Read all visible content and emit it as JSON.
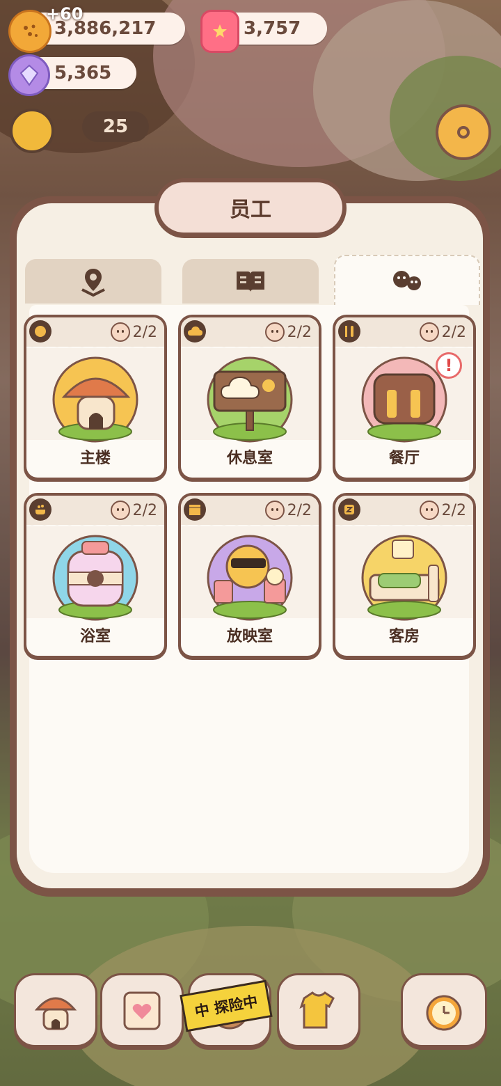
{
  "currencies": {
    "cookies": "3,886,217",
    "cookies_gain": "+60",
    "jelly": "3,757",
    "crystals": "5,365"
  },
  "hud": {
    "level_value": "25"
  },
  "panel": {
    "title": "员工",
    "tabs": [
      {
        "icon": "map-pin-icon",
        "active": false
      },
      {
        "icon": "book-icon",
        "active": false
      },
      {
        "icon": "cookie-group-icon",
        "active": true
      }
    ],
    "rooms": [
      {
        "label": "主楼",
        "count": "2/2",
        "icon": "cookie-icon"
      },
      {
        "label": "休息室",
        "count": "2/2",
        "icon": "cloud-icon"
      },
      {
        "label": "餐厅",
        "count": "2/2",
        "icon": "fork-knife-icon",
        "alert": "!"
      },
      {
        "label": "浴室",
        "count": "2/2",
        "icon": "bath-icon"
      },
      {
        "label": "放映室",
        "count": "2/2",
        "icon": "clapperboard-icon"
      },
      {
        "label": "客房",
        "count": "2/2",
        "icon": "sleep-icon"
      }
    ]
  },
  "bottom_nav": {
    "exploring_banner": "中 探险中",
    "items": [
      "house-icon",
      "diary-icon",
      "explore-icon",
      "shirt-icon",
      "alarm-clock-icon"
    ]
  },
  "colors": {
    "frame": "#7c5446",
    "panel": "#f6efe4",
    "card": "#fdfaf5"
  }
}
